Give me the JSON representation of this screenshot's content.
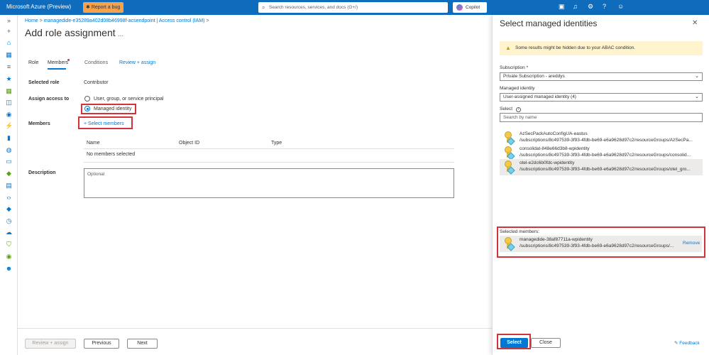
{
  "topbar": {
    "brand": "Microsoft Azure (Preview)",
    "report_bug": "Report a bug",
    "search_placeholder": "Search resources, services, and docs (G+/)",
    "copilot": "Copilot"
  },
  "blade": {
    "breadcrumb": {
      "home": "Home",
      "sep": ">",
      "resource": "managedide-e35289a402d08b46998f-acsendpoint | Access control (IAM)"
    },
    "title": "Add role assignment",
    "more": "...",
    "tabs": [
      {
        "label": "Role"
      },
      {
        "label": "Members"
      },
      {
        "label": "Conditions"
      },
      {
        "label": "Review + assign"
      }
    ],
    "selected_role_label": "Selected role",
    "selected_role_value": "Contributor",
    "assign_access_label": "Assign access to",
    "option_user": "User, group, or service principal",
    "option_managed": "Managed identity",
    "members_label": "Members",
    "select_members": "+ Select members",
    "table_headers": {
      "name": "Name",
      "object_id": "Object ID",
      "type": "Type"
    },
    "no_members": "No members selected",
    "description_label": "Description",
    "description_placeholder": "Optional",
    "footer": {
      "review": "Review + assign",
      "previous": "Previous",
      "next": "Next"
    }
  },
  "panel": {
    "title": "Select managed identities",
    "warning": "Some results might be hidden due to your ABAC condition.",
    "subscription_label": "Subscription *",
    "subscription_value": "Private Subscription - areddys",
    "managed_identity_label": "Managed identity",
    "managed_identity_value": "User-assigned managed identity (4)",
    "select_label": "Select",
    "search_placeholder": "Search by name",
    "items": [
      {
        "name": "AzSecPackAutoConfigUA-eastus",
        "path": "/subscriptions/8c497539-3f93-4fdb-be69-e6a9628d97c2/resourceGroups/AzSecPa..."
      },
      {
        "name": "consolidat-848e66d3b8-wpidentity",
        "path": "/subscriptions/8c497539-3f93-4fdb-be69-e6a9628d97c2/resourceGroups/consolid..."
      },
      {
        "name": "otel-e2dc6b0fdc-wpidentity",
        "path": "/subscriptions/8c497539-3f93-4fdb-be69-e6a9628d97c2/resourceGroups/otel_gro..."
      }
    ],
    "selected_members_label": "Selected members:",
    "selected_member": {
      "name": "managedide-38af87711a-wpidentity",
      "path": "/subscriptions/8c497539-3f93-4fdb-be69-e6a9628d97c2/resourceGroups/...",
      "remove": "Remove"
    },
    "select_button": "Select",
    "close_button": "Close",
    "feedback": "Feedback"
  },
  "colors": {
    "accent": "#0078d4",
    "topbar": "#0f6cbd",
    "highlight_box": "#d13438"
  }
}
